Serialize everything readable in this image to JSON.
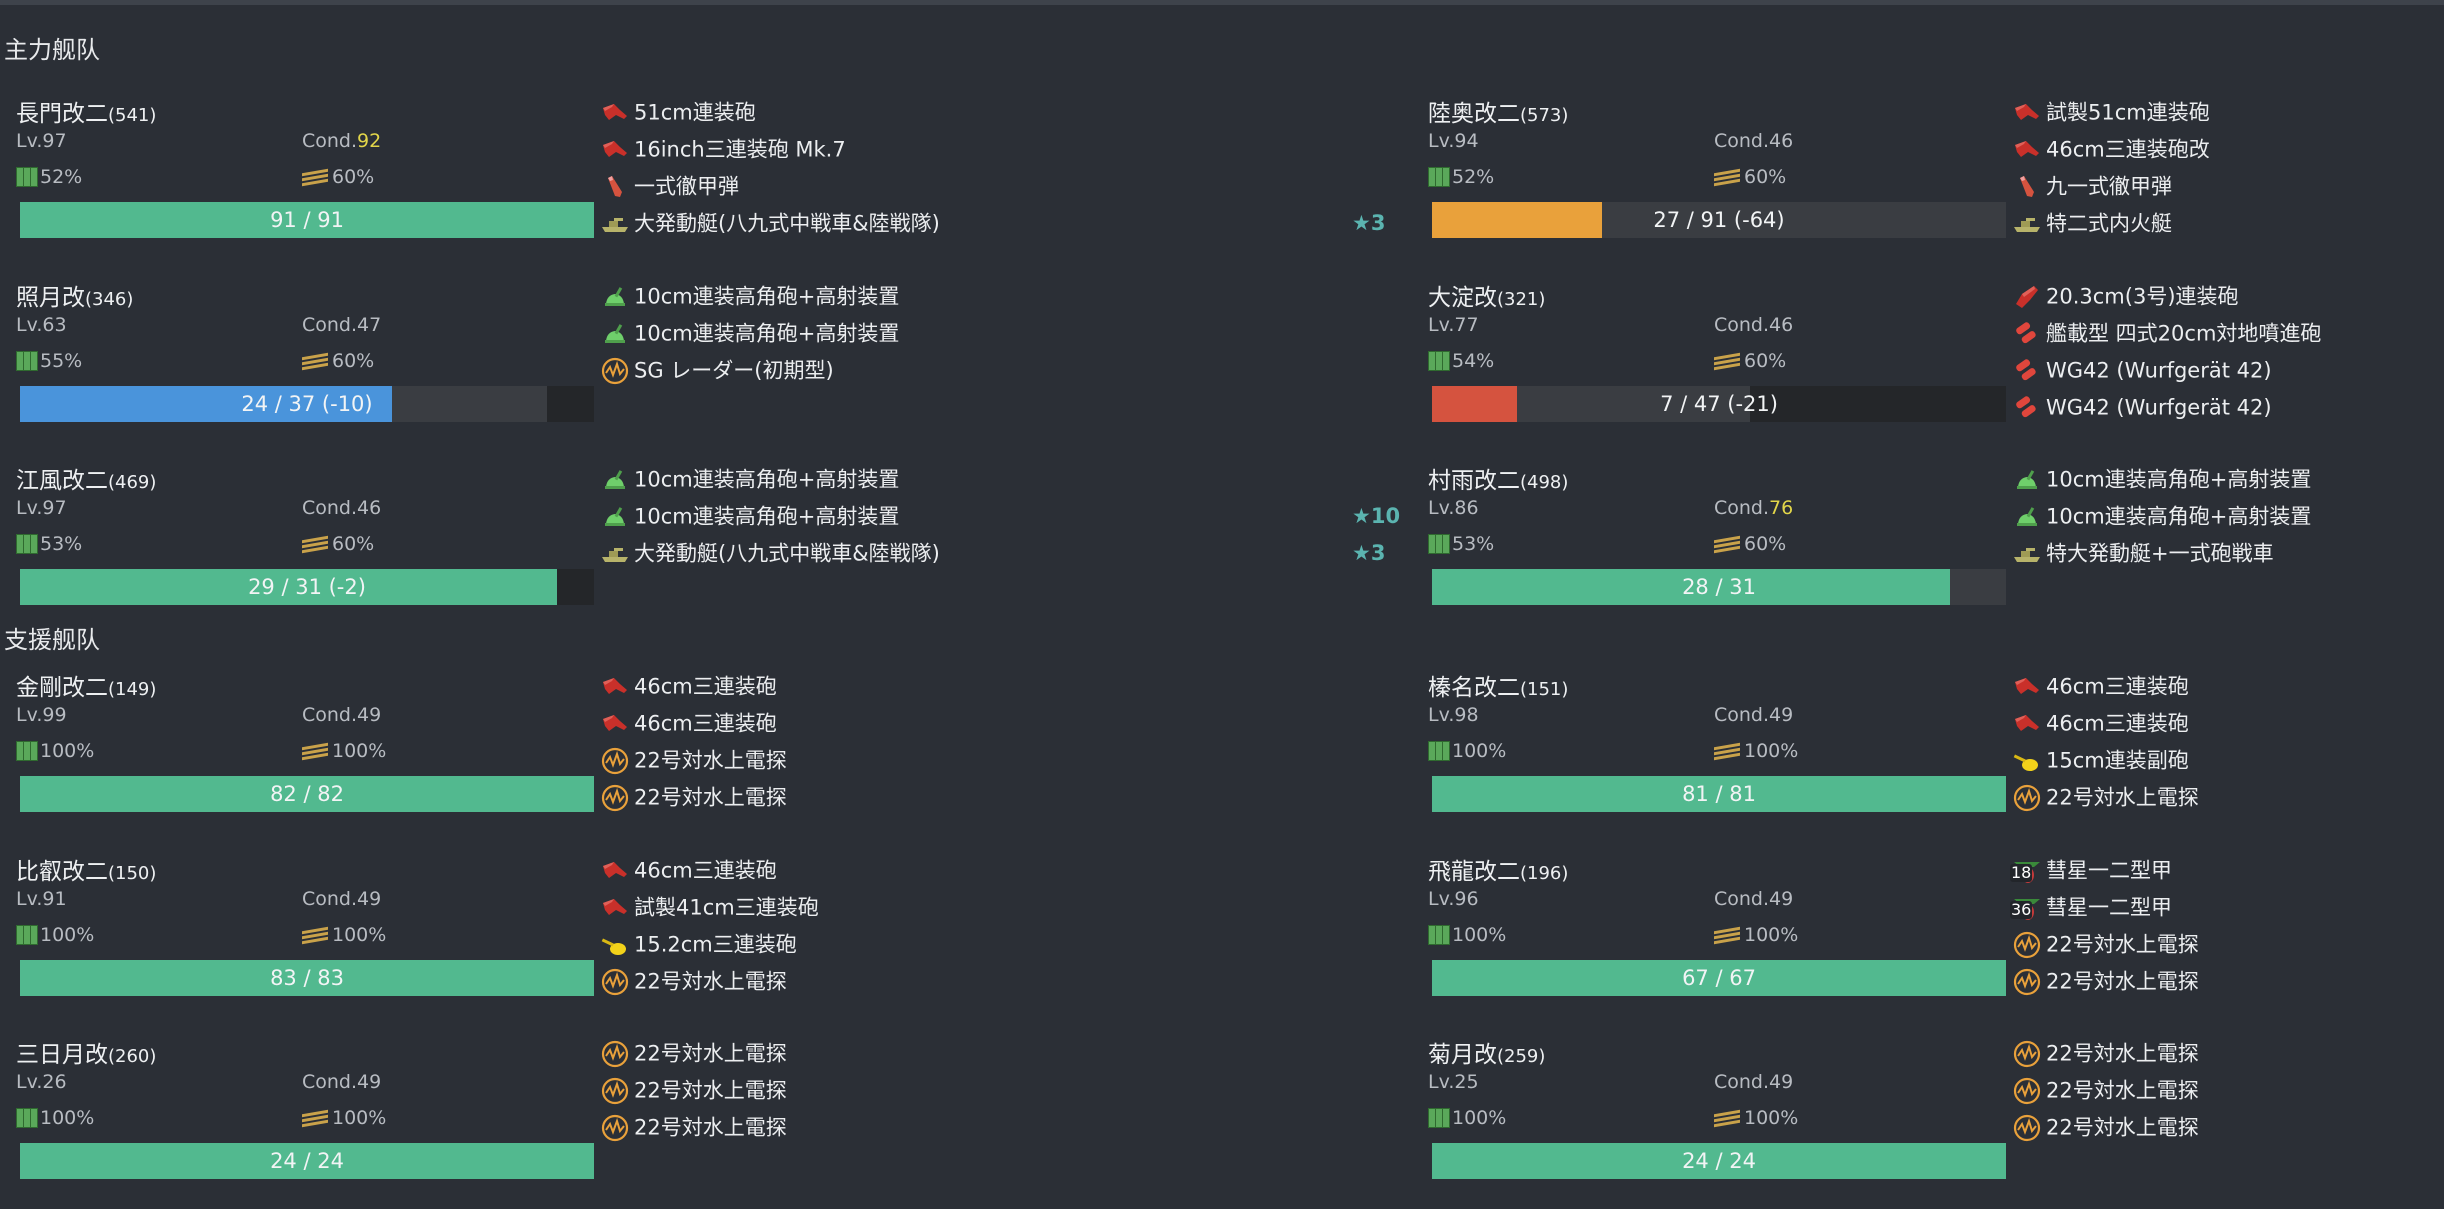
{
  "colors": {
    "background": "#2b2f36",
    "hp_green": "#52b98f",
    "hp_orange": "#e9a13b",
    "hp_blue": "#4a94db",
    "hp_red": "#d5533f",
    "star_teal": "#5bb4b0",
    "cond_yellow": "#e2d64a"
  },
  "sections": [
    {
      "title": "主力舰队",
      "ships": [
        {
          "name": "長門改二",
          "id": "(541)",
          "lv": "Lv.97",
          "cond_label": "Cond.",
          "cond": "92",
          "cond_high": true,
          "fuel": "52%",
          "ammo": "60%",
          "hp": {
            "text": "91 / 91",
            "current": 91,
            "max": 91,
            "reduced_max": 91,
            "state": "green"
          },
          "equipment": [
            {
              "icon": "main-gun-large-icon",
              "name": "51cm連装砲",
              "stars": ""
            },
            {
              "icon": "main-gun-large-icon",
              "name": "16inch三連装砲 Mk.7",
              "stars": ""
            },
            {
              "icon": "ap-shell-icon",
              "name": "一式徹甲弾",
              "stars": ""
            },
            {
              "icon": "landing-craft-icon",
              "name": "大発動艇(八九式中戦車&陸戦隊)",
              "stars": "★3"
            }
          ]
        },
        {
          "name": "陸奥改二",
          "id": "(573)",
          "lv": "Lv.94",
          "cond_label": "Cond.",
          "cond": "46",
          "cond_high": false,
          "fuel": "52%",
          "ammo": "60%",
          "hp": {
            "text": "27 / 91 (-64)",
            "current": 27,
            "max": 91,
            "reduced_max": 91,
            "state": "orange"
          },
          "equipment": [
            {
              "icon": "main-gun-large-icon",
              "name": "試製51cm連装砲",
              "stars": ""
            },
            {
              "icon": "main-gun-large-icon",
              "name": "46cm三連装砲改",
              "stars": ""
            },
            {
              "icon": "ap-shell-icon",
              "name": "九一式徹甲弾",
              "stars": ""
            },
            {
              "icon": "landing-craft-icon",
              "name": "特二式内火艇",
              "stars": ""
            }
          ]
        },
        {
          "name": "照月改",
          "id": "(346)",
          "lv": "Lv.63",
          "cond_label": "Cond.",
          "cond": "47",
          "cond_high": false,
          "fuel": "55%",
          "ammo": "60%",
          "hp": {
            "text": "24 / 37 (-10)",
            "current": 24,
            "max": 37,
            "reduced_max": 34,
            "state": "blue"
          },
          "equipment": [
            {
              "icon": "aa-gun-icon",
              "name": "10cm連装高角砲+高射装置",
              "stars": ""
            },
            {
              "icon": "aa-gun-icon",
              "name": "10cm連装高角砲+高射装置",
              "stars": ""
            },
            {
              "icon": "radar-icon",
              "name": "SG レーダー(初期型)",
              "stars": ""
            }
          ]
        },
        {
          "name": "大淀改",
          "id": "(321)",
          "lv": "Lv.77",
          "cond_label": "Cond.",
          "cond": "46",
          "cond_high": false,
          "fuel": "54%",
          "ammo": "60%",
          "hp": {
            "text": "7 / 47 (-21)",
            "current": 7,
            "max": 47,
            "reduced_max": 26,
            "state": "red"
          },
          "equipment": [
            {
              "icon": "main-gun-medium-icon",
              "name": "20.3cm(3号)連装砲",
              "stars": ""
            },
            {
              "icon": "rocket-launcher-icon",
              "name": "艦載型 四式20cm対地噴進砲",
              "stars": ""
            },
            {
              "icon": "rocket-launcher-icon",
              "name": "WG42 (Wurfgerät 42)",
              "stars": ""
            },
            {
              "icon": "rocket-launcher-icon",
              "name": "WG42 (Wurfgerät 42)",
              "stars": ""
            }
          ]
        },
        {
          "name": "江風改二",
          "id": "(469)",
          "lv": "Lv.97",
          "cond_label": "Cond.",
          "cond": "46",
          "cond_high": false,
          "fuel": "53%",
          "ammo": "60%",
          "hp": {
            "text": "29 / 31 (-2)",
            "current": 29,
            "max": 31,
            "reduced_max": 29,
            "state": "green"
          },
          "equipment": [
            {
              "icon": "aa-gun-icon",
              "name": "10cm連装高角砲+高射装置",
              "stars": ""
            },
            {
              "icon": "aa-gun-icon",
              "name": "10cm連装高角砲+高射装置",
              "stars": "★10"
            },
            {
              "icon": "landing-craft-icon",
              "name": "大発動艇(八九式中戦車&陸戦隊)",
              "stars": "★3"
            }
          ]
        },
        {
          "name": "村雨改二",
          "id": "(498)",
          "lv": "Lv.86",
          "cond_label": "Cond.",
          "cond": "76",
          "cond_high": true,
          "fuel": "53%",
          "ammo": "60%",
          "hp": {
            "text": "28 / 31",
            "current": 28,
            "max": 31,
            "reduced_max": 31,
            "state": "green"
          },
          "equipment": [
            {
              "icon": "aa-gun-icon",
              "name": "10cm連装高角砲+高射装置",
              "stars": ""
            },
            {
              "icon": "aa-gun-icon",
              "name": "10cm連装高角砲+高射装置",
              "stars": ""
            },
            {
              "icon": "landing-craft-icon",
              "name": "特大発動艇+一式砲戦車",
              "stars": ""
            }
          ]
        }
      ]
    },
    {
      "title": "支援舰队",
      "ships": [
        {
          "name": "金剛改二",
          "id": "(149)",
          "lv": "Lv.99",
          "cond_label": "Cond.",
          "cond": "49",
          "cond_high": false,
          "fuel": "100%",
          "ammo": "100%",
          "hp": {
            "text": "82 / 82",
            "current": 82,
            "max": 82,
            "reduced_max": 82,
            "state": "green"
          },
          "equipment": [
            {
              "icon": "main-gun-large-icon",
              "name": "46cm三連装砲",
              "stars": ""
            },
            {
              "icon": "main-gun-large-icon",
              "name": "46cm三連装砲",
              "stars": ""
            },
            {
              "icon": "radar-icon",
              "name": "22号対水上電探",
              "stars": ""
            },
            {
              "icon": "radar-icon",
              "name": "22号対水上電探",
              "stars": ""
            }
          ]
        },
        {
          "name": "榛名改二",
          "id": "(151)",
          "lv": "Lv.98",
          "cond_label": "Cond.",
          "cond": "49",
          "cond_high": false,
          "fuel": "100%",
          "ammo": "100%",
          "hp": {
            "text": "81 / 81",
            "current": 81,
            "max": 81,
            "reduced_max": 81,
            "state": "green"
          },
          "equipment": [
            {
              "icon": "main-gun-large-icon",
              "name": "46cm三連装砲",
              "stars": ""
            },
            {
              "icon": "main-gun-large-icon",
              "name": "46cm三連装砲",
              "stars": ""
            },
            {
              "icon": "secondary-gun-icon",
              "name": "15cm連装副砲",
              "stars": ""
            },
            {
              "icon": "radar-icon",
              "name": "22号対水上電探",
              "stars": ""
            }
          ]
        },
        {
          "name": "比叡改二",
          "id": "(150)",
          "lv": "Lv.91",
          "cond_label": "Cond.",
          "cond": "49",
          "cond_high": false,
          "fuel": "100%",
          "ammo": "100%",
          "hp": {
            "text": "83 / 83",
            "current": 83,
            "max": 83,
            "reduced_max": 83,
            "state": "green"
          },
          "equipment": [
            {
              "icon": "main-gun-large-icon",
              "name": "46cm三連装砲",
              "stars": ""
            },
            {
              "icon": "main-gun-large-icon",
              "name": "試製41cm三連装砲",
              "stars": ""
            },
            {
              "icon": "secondary-gun-icon",
              "name": "15.2cm三連装砲",
              "stars": ""
            },
            {
              "icon": "radar-icon",
              "name": "22号対水上電探",
              "stars": ""
            }
          ]
        },
        {
          "name": "飛龍改二",
          "id": "(196)",
          "lv": "Lv.96",
          "cond_label": "Cond.",
          "cond": "49",
          "cond_high": false,
          "fuel": "100%",
          "ammo": "100%",
          "hp": {
            "text": "67 / 67",
            "current": 67,
            "max": 67,
            "reduced_max": 67,
            "state": "green"
          },
          "equipment": [
            {
              "icon": "dive-bomber-icon",
              "name": "彗星一二型甲",
              "stars": "",
              "count": "18"
            },
            {
              "icon": "dive-bomber-icon",
              "name": "彗星一二型甲",
              "stars": "",
              "count": "36"
            },
            {
              "icon": "radar-icon",
              "name": "22号対水上電探",
              "stars": ""
            },
            {
              "icon": "radar-icon",
              "name": "22号対水上電探",
              "stars": ""
            }
          ]
        },
        {
          "name": "三日月改",
          "id": "(260)",
          "lv": "Lv.26",
          "cond_label": "Cond.",
          "cond": "49",
          "cond_high": false,
          "fuel": "100%",
          "ammo": "100%",
          "hp": {
            "text": "24 / 24",
            "current": 24,
            "max": 24,
            "reduced_max": 24,
            "state": "green"
          },
          "equipment": [
            {
              "icon": "radar-icon",
              "name": "22号対水上電探",
              "stars": ""
            },
            {
              "icon": "radar-icon",
              "name": "22号対水上電探",
              "stars": ""
            },
            {
              "icon": "radar-icon",
              "name": "22号対水上電探",
              "stars": ""
            }
          ]
        },
        {
          "name": "菊月改",
          "id": "(259)",
          "lv": "Lv.25",
          "cond_label": "Cond.",
          "cond": "49",
          "cond_high": false,
          "fuel": "100%",
          "ammo": "100%",
          "hp": {
            "text": "24 / 24",
            "current": 24,
            "max": 24,
            "reduced_max": 24,
            "state": "green"
          },
          "equipment": [
            {
              "icon": "radar-icon",
              "name": "22号対水上電探",
              "stars": ""
            },
            {
              "icon": "radar-icon",
              "name": "22号対水上電探",
              "stars": ""
            },
            {
              "icon": "radar-icon",
              "name": "22号対水上電探",
              "stars": ""
            }
          ]
        }
      ]
    }
  ]
}
